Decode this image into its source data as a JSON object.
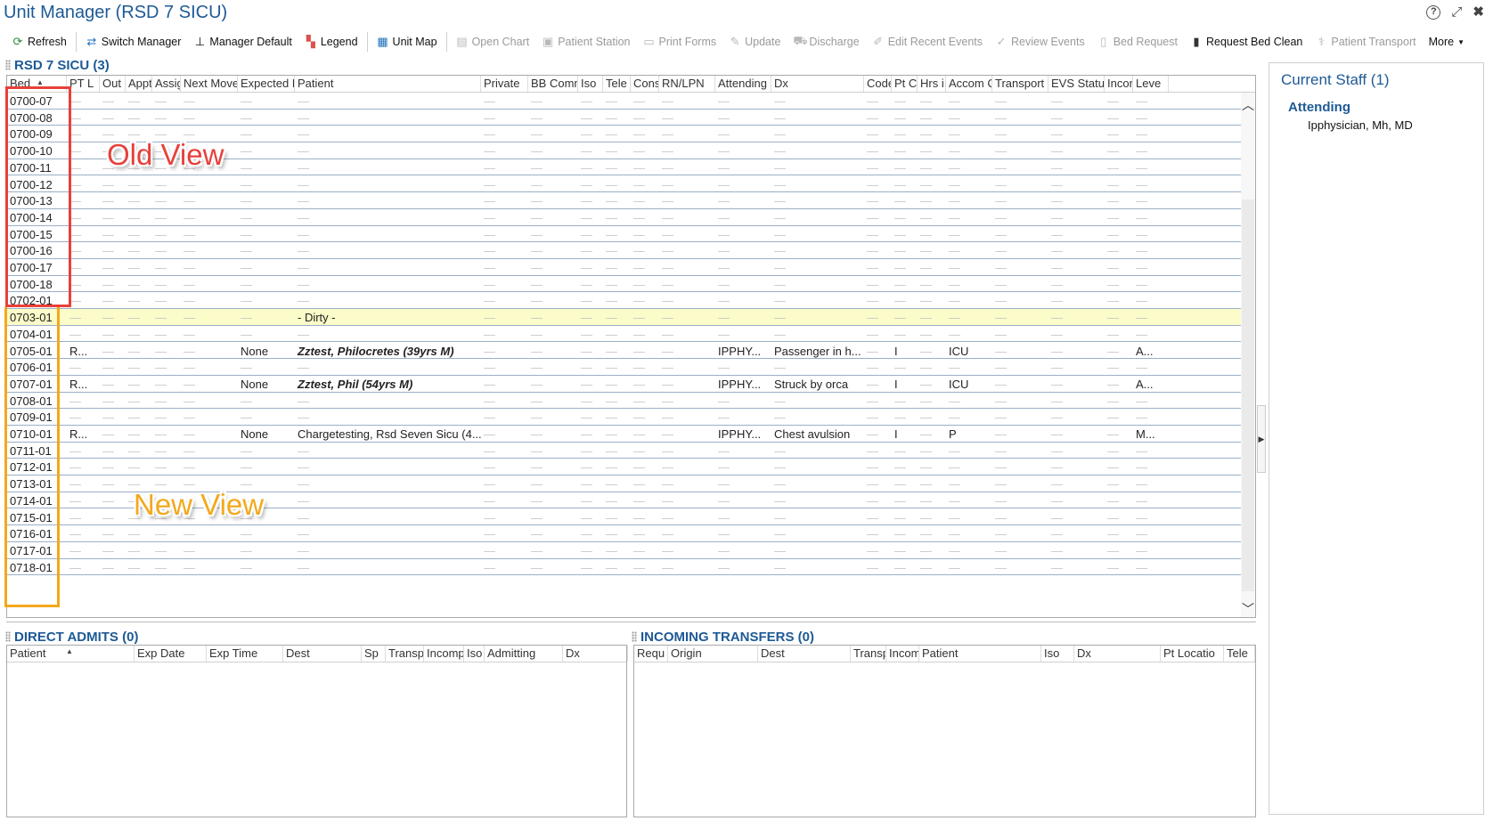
{
  "window": {
    "title": "Unit Manager (RSD 7 SICU)"
  },
  "toolbar": {
    "items": [
      {
        "label": "Refresh",
        "enabled": true,
        "icon": "refresh-icon"
      },
      {
        "label": "Switch Manager",
        "enabled": true,
        "icon": "switch-icon"
      },
      {
        "label": "Manager Default",
        "enabled": true,
        "icon": "default-icon"
      },
      {
        "label": "Legend",
        "enabled": true,
        "icon": "legend-icon"
      },
      {
        "label": "Unit Map",
        "enabled": true,
        "icon": "map-icon"
      },
      {
        "label": "Open Chart",
        "enabled": false,
        "icon": "chart-icon"
      },
      {
        "label": "Patient Station",
        "enabled": false,
        "icon": "station-icon"
      },
      {
        "label": "Print Forms",
        "enabled": false,
        "icon": "print-icon"
      },
      {
        "label": "Update",
        "enabled": false,
        "icon": "update-icon"
      },
      {
        "label": "Discharge",
        "enabled": false,
        "icon": "discharge-icon"
      },
      {
        "label": "Edit Recent Events",
        "enabled": false,
        "icon": "edit-icon"
      },
      {
        "label": "Review Events",
        "enabled": false,
        "icon": "check-icon"
      },
      {
        "label": "Bed Request",
        "enabled": false,
        "icon": "bed-icon"
      },
      {
        "label": "Request Bed Clean",
        "enabled": true,
        "icon": "clean-icon"
      },
      {
        "label": "Patient Transport",
        "enabled": false,
        "icon": "transport-icon"
      },
      {
        "label": "More",
        "enabled": true,
        "icon": "chevron-down-icon"
      }
    ]
  },
  "unit": {
    "title": "RSD 7 SICU (3)",
    "columns": [
      "Bed",
      "PT L",
      "Out",
      "Appt",
      "Assig",
      "Next Move",
      "Expected D",
      "Patient",
      "Private",
      "BB Comm",
      "Iso",
      "Tele",
      "Cons",
      "RN/LPN",
      "Attending",
      "Dx",
      "Code",
      "Pt Cl",
      "Hrs i",
      "Accom C",
      "Transport",
      "EVS Status",
      "Incon",
      "Leve"
    ],
    "empty_marker": "—",
    "rows": [
      {
        "bed": "0700-07"
      },
      {
        "bed": "0700-08"
      },
      {
        "bed": "0700-09"
      },
      {
        "bed": "0700-10"
      },
      {
        "bed": "0700-11"
      },
      {
        "bed": "0700-12"
      },
      {
        "bed": "0700-13"
      },
      {
        "bed": "0700-14"
      },
      {
        "bed": "0700-15"
      },
      {
        "bed": "0700-16"
      },
      {
        "bed": "0700-17"
      },
      {
        "bed": "0700-18"
      },
      {
        "bed": "0702-01"
      },
      {
        "bed": "0703-01",
        "highlight": "#fbfcc9",
        "patient": "- Dirty -"
      },
      {
        "bed": "0704-01"
      },
      {
        "bed": "0705-01",
        "ptl": "R...",
        "expected": "None",
        "patient": "Zztest, Philocretes (39yrs M)",
        "patient_style": "bold-italic",
        "attending": "IPPHY...",
        "dx": "Passenger in h...",
        "ptcl": "I",
        "accom": "ICU",
        "level": "A..."
      },
      {
        "bed": "0706-01"
      },
      {
        "bed": "0707-01",
        "ptl": "R...",
        "expected": "None",
        "patient": "Zztest, Phil (54yrs M)",
        "patient_style": "bold-italic",
        "attending": "IPPHY...",
        "dx": "Struck by orca",
        "ptcl": "I",
        "accom": "ICU",
        "level": "A..."
      },
      {
        "bed": "0708-01"
      },
      {
        "bed": "0709-01"
      },
      {
        "bed": "0710-01",
        "ptl": "R...",
        "expected": "None",
        "patient": "Chargetesting, Rsd Seven Sicu (4...",
        "attending": "IPPHY...",
        "dx": "Chest avulsion",
        "ptcl": "I",
        "accom": "P",
        "level": "M..."
      },
      {
        "bed": "0711-01"
      },
      {
        "bed": "0712-01"
      },
      {
        "bed": "0713-01"
      },
      {
        "bed": "0714-01"
      },
      {
        "bed": "0715-01"
      },
      {
        "bed": "0716-01"
      },
      {
        "bed": "0717-01"
      },
      {
        "bed": "0718-01"
      }
    ]
  },
  "annotations": {
    "old_view": "Old View",
    "new_view": "New View",
    "old_color": "#e8403a",
    "new_color": "#f3a81c"
  },
  "direct_admits": {
    "title": "DIRECT ADMITS (0)",
    "columns": [
      "Patient",
      "Exp Date",
      "Exp Time",
      "Dest",
      "Sp",
      "Transp",
      "Incomp",
      "Iso",
      "Admitting",
      "Dx"
    ]
  },
  "incoming_transfers": {
    "title": "INCOMING TRANSFERS (0)",
    "columns": [
      "Requ",
      "Origin",
      "Dest",
      "Transp",
      "Incom",
      "Patient",
      "Iso",
      "Dx",
      "Pt Locatio",
      "Tele"
    ]
  },
  "staff": {
    "title": "Current Staff (1)",
    "role": "Attending",
    "name": "Ipphysician, Mh, MD"
  },
  "colors": {
    "title_blue": "#1e5a96",
    "row_highlight": "#fbfcc9",
    "row_border": "#9ab0c6"
  }
}
